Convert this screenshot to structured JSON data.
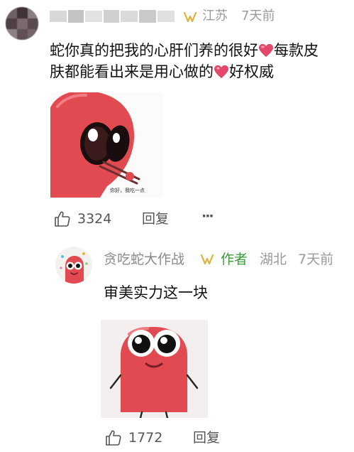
{
  "comment": {
    "author_name": "",
    "location": "江苏",
    "time": "7天前",
    "text_line1": "蛇你真的把我的心肝们养的很好",
    "text_line1_tail": "每款皮",
    "text_line2": "肤都能看出来是用心做的",
    "text_line2_tail": "好权威",
    "sticker_caption": "你好，我吃一点",
    "likes": "3324",
    "reply_label": "回复",
    "more_label": "···"
  },
  "reply": {
    "author_name": "贪吃蛇大作战",
    "author_badge": "作者",
    "location": "湖北",
    "time": "7天前",
    "text": "审美实力这一块",
    "likes": "1772",
    "reply_label": "回复"
  },
  "colors": {
    "heart": "#e4476a",
    "author_green": "#3a9b3a",
    "vip_gold": "#e0b23a",
    "snake_red": "#e24a52"
  }
}
